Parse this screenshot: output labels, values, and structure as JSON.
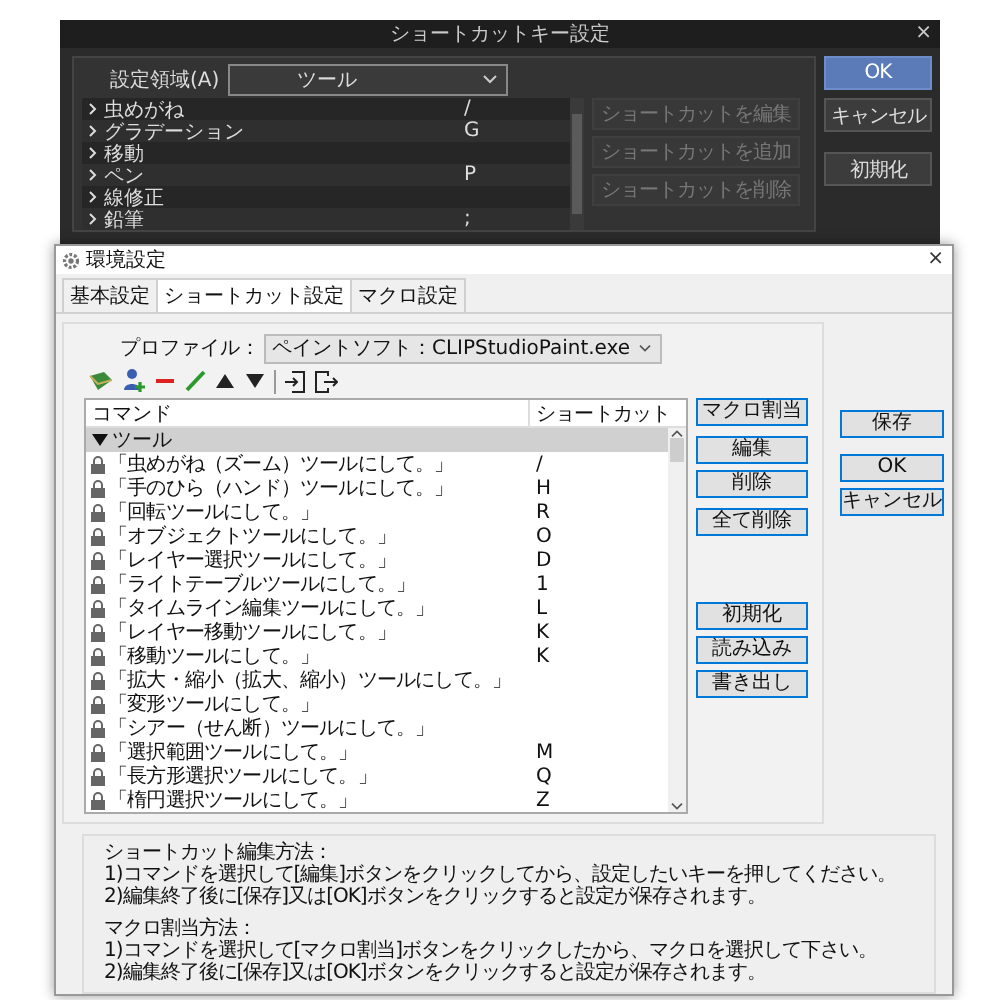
{
  "back_dialog": {
    "title": "ショートカットキー設定",
    "close": "×",
    "area_label": "設定領域(A)",
    "area_value": "ツール",
    "rows": [
      {
        "name": "虫めがね",
        "key": "/"
      },
      {
        "name": "グラデーション",
        "key": "G"
      },
      {
        "name": "移動"
      },
      {
        "name": "ペン",
        "key": "P"
      },
      {
        "name": "線修正"
      },
      {
        "name": "鉛筆",
        "key": ";"
      }
    ],
    "side_buttons": [
      {
        "label": "ショートカットを編集",
        "disabled": true
      },
      {
        "label": "ショートカットを追加",
        "disabled": true
      },
      {
        "label": "ショートカットを削除",
        "disabled": true
      }
    ],
    "buttons": [
      {
        "label": "OK",
        "kind": "primary"
      },
      {
        "label": "キャンセル",
        "kind": "normal"
      },
      {
        "label": "初期化",
        "kind": "normal"
      }
    ]
  },
  "front_dialog": {
    "title": "環境設定",
    "close": "×",
    "tabs": [
      {
        "label": "基本設定",
        "selected": false
      },
      {
        "label": "ショートカット設定",
        "selected": true
      },
      {
        "label": "マクロ設定",
        "selected": false
      }
    ],
    "profile_label": "プロファイル：",
    "profile_value": "ペイントソフト：CLIPStudioPaint.exe",
    "columns": [
      "コマンド",
      "ショートカット"
    ],
    "group": {
      "label": "ツール",
      "expanded": true,
      "selected": true
    },
    "rows": [
      {
        "command": "「虫めがね（ズーム）ツールにして。」",
        "shortcut": "/",
        "locked": true
      },
      {
        "command": "「手のひら（ハンド）ツールにして。」",
        "shortcut": "H",
        "locked": true
      },
      {
        "command": "「回転ツールにして。」",
        "shortcut": "R",
        "locked": true
      },
      {
        "command": "「オブジェクトツールにして。」",
        "shortcut": "O",
        "locked": true
      },
      {
        "command": "「レイヤー選択ツールにして。」",
        "shortcut": "D",
        "locked": true
      },
      {
        "command": "「ライトテーブルツールにして。」",
        "shortcut": "1",
        "locked": true
      },
      {
        "command": "「タイムライン編集ツールにして。」",
        "shortcut": "L",
        "locked": true
      },
      {
        "command": "「レイヤー移動ツールにして。」",
        "shortcut": "K",
        "locked": true
      },
      {
        "command": "「移動ツールにして。」",
        "shortcut": "K",
        "locked": true
      },
      {
        "command": "「拡大・縮小（拡大、縮小）ツールにして。」",
        "locked": true
      },
      {
        "command": "「変形ツールにして。」",
        "locked": true
      },
      {
        "command": "「シアー（せん断）ツールにして。」",
        "locked": true
      },
      {
        "command": "「選択範囲ツールにして。」",
        "shortcut": "M",
        "locked": true
      },
      {
        "command": "「長方形選択ツールにして。」",
        "shortcut": "Q",
        "locked": true
      },
      {
        "command": "「楕円選択ツールにして。」",
        "shortcut": "Z",
        "locked": true
      }
    ],
    "list_buttons": [
      {
        "label": "マクロ割当"
      },
      {
        "label": "編集"
      },
      {
        "label": "削除"
      },
      {
        "label": "全て削除"
      },
      {
        "label": "初期化"
      },
      {
        "label": "読み込み"
      },
      {
        "label": "書き出し"
      }
    ],
    "dialog_buttons": [
      {
        "label": "保存"
      },
      {
        "label": "OK"
      },
      {
        "label": "キャンセル"
      }
    ],
    "help": [
      {
        "heading": "ショートカット編集方法：",
        "lines": [
          "1)コマンドを選択して[編集]ボタンをクリックしてから、設定したいキーを押してください。",
          "2)編集終了後に[保存]又は[OK]ボタンをクリックすると設定が保存されます。"
        ]
      },
      {
        "heading": "マクロ割当方法：",
        "lines": [
          "1)コマンドを選択して[マクロ割当]ボタンをクリックしたから、マクロを選択して下さい。",
          "2)編集終了後に[保存]又は[OK]ボタンをクリックすると設定が保存されます。"
        ]
      }
    ]
  }
}
